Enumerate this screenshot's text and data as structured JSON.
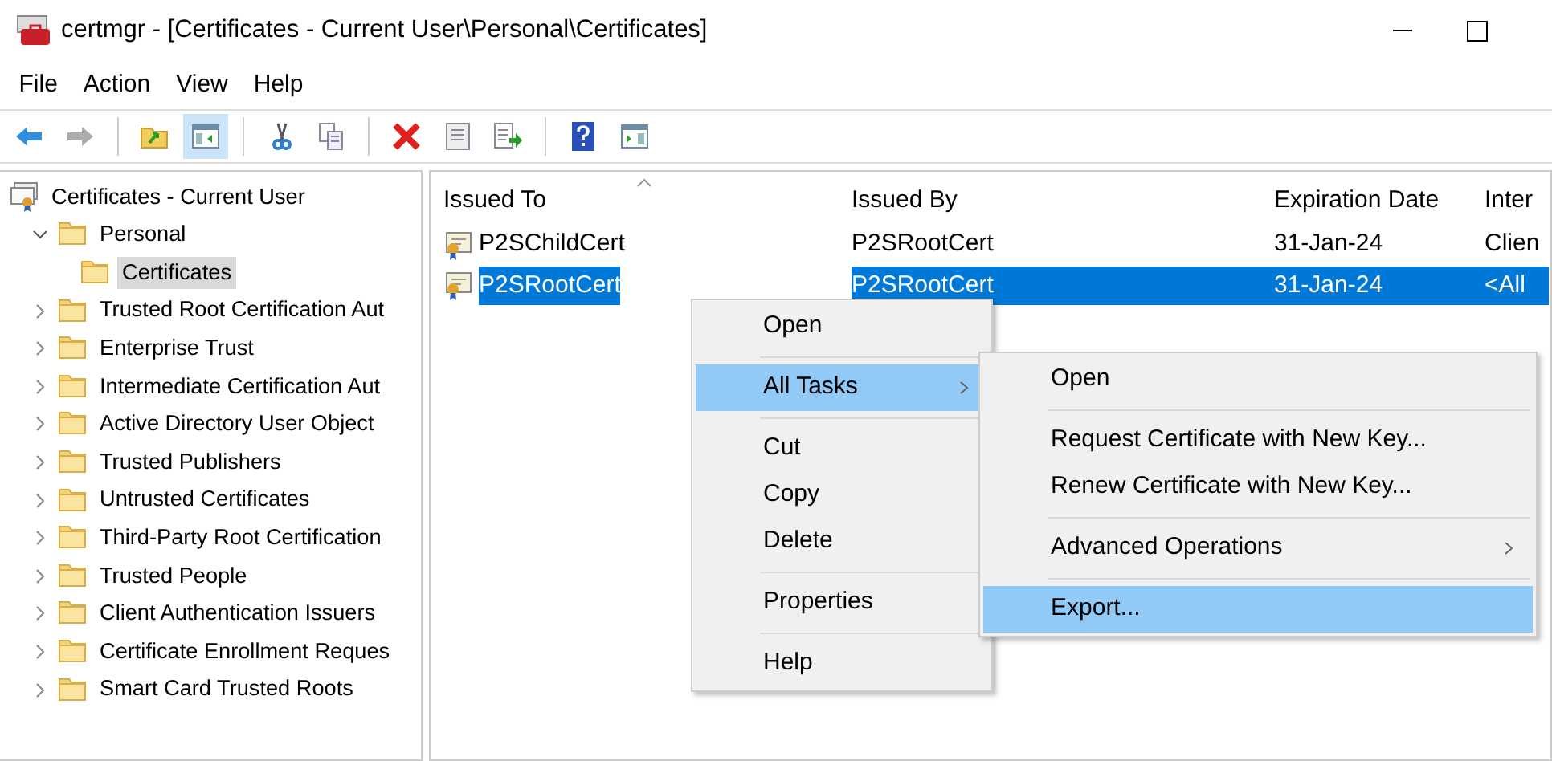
{
  "window": {
    "title": "certmgr - [Certificates - Current User\\Personal\\Certificates]"
  },
  "menubar": [
    "File",
    "Action",
    "View",
    "Help"
  ],
  "toolbar": [
    {
      "kind": "back",
      "disabled": false,
      "pressed": false
    },
    {
      "kind": "forward",
      "disabled": true,
      "pressed": false
    },
    {
      "kind": "sep"
    },
    {
      "kind": "up",
      "disabled": false,
      "pressed": false
    },
    {
      "kind": "tree",
      "disabled": false,
      "pressed": true
    },
    {
      "kind": "sep"
    },
    {
      "kind": "cut",
      "disabled": false,
      "pressed": false
    },
    {
      "kind": "copy",
      "disabled": false,
      "pressed": false
    },
    {
      "kind": "sep"
    },
    {
      "kind": "delete",
      "disabled": false,
      "pressed": false
    },
    {
      "kind": "properties",
      "disabled": false,
      "pressed": false
    },
    {
      "kind": "export",
      "disabled": false,
      "pressed": false
    },
    {
      "kind": "sep"
    },
    {
      "kind": "help",
      "disabled": false,
      "pressed": false
    },
    {
      "kind": "actionpane",
      "disabled": false,
      "pressed": false
    }
  ],
  "tree": [
    {
      "label": "Certificates - Current User",
      "kind": "store",
      "selected": false,
      "children": [
        {
          "label": "Personal",
          "kind": "folder",
          "expanded": true,
          "expandable": true,
          "selected": false,
          "children": [
            {
              "label": "Certificates",
              "kind": "folder",
              "expandable": false,
              "selected": true
            }
          ]
        },
        {
          "label": "Trusted Root Certification Aut",
          "kind": "folder",
          "expanded": false,
          "expandable": true,
          "selected": false
        },
        {
          "label": "Enterprise Trust",
          "kind": "folder",
          "expanded": false,
          "expandable": true,
          "selected": false
        },
        {
          "label": "Intermediate Certification Aut",
          "kind": "folder",
          "expanded": false,
          "expandable": true,
          "selected": false
        },
        {
          "label": "Active Directory User Object",
          "kind": "folder",
          "expanded": false,
          "expandable": true,
          "selected": false
        },
        {
          "label": "Trusted Publishers",
          "kind": "folder",
          "expanded": false,
          "expandable": true,
          "selected": false
        },
        {
          "label": "Untrusted Certificates",
          "kind": "folder",
          "expanded": false,
          "expandable": true,
          "selected": false
        },
        {
          "label": "Third-Party Root Certification",
          "kind": "folder",
          "expanded": false,
          "expandable": true,
          "selected": false
        },
        {
          "label": "Trusted People",
          "kind": "folder",
          "expanded": false,
          "expandable": true,
          "selected": false
        },
        {
          "label": "Client Authentication Issuers",
          "kind": "folder",
          "expanded": false,
          "expandable": true,
          "selected": false
        },
        {
          "label": "Certificate Enrollment Reques",
          "kind": "folder",
          "expanded": false,
          "expandable": true,
          "selected": false
        },
        {
          "label": "Smart Card Trusted Roots",
          "kind": "folder",
          "expanded": false,
          "expandable": true,
          "selected": false
        }
      ]
    }
  ],
  "table": {
    "columns": [
      "Issued To",
      "Issued By",
      "Expiration Date",
      "Inter"
    ],
    "rows": [
      {
        "cells": [
          "P2SChildCert",
          "P2SRootCert",
          "31-Jan-24",
          "Clien"
        ],
        "selected": false
      },
      {
        "cells": [
          "P2SRootCert",
          "P2SRootCert",
          "31-Jan-24",
          "<All"
        ],
        "selected": true
      }
    ]
  },
  "context_menu": {
    "groups": [
      [
        {
          "label": "Open",
          "selected": false,
          "submenu": false
        }
      ],
      [
        {
          "label": "All Tasks",
          "selected": true,
          "submenu": true
        }
      ],
      [
        {
          "label": "Cut",
          "selected": false,
          "submenu": false
        },
        {
          "label": "Copy",
          "selected": false,
          "submenu": false
        },
        {
          "label": "Delete",
          "selected": false,
          "submenu": false
        }
      ],
      [
        {
          "label": "Properties",
          "selected": false,
          "submenu": false
        }
      ],
      [
        {
          "label": "Help",
          "selected": false,
          "submenu": false
        }
      ]
    ]
  },
  "submenu": {
    "groups": [
      [
        {
          "label": "Open",
          "selected": false,
          "submenu": false
        }
      ],
      [
        {
          "label": "Request Certificate with New Key...",
          "selected": false,
          "submenu": false
        },
        {
          "label": "Renew Certificate with New Key...",
          "selected": false,
          "submenu": false
        }
      ],
      [
        {
          "label": "Advanced Operations",
          "selected": false,
          "submenu": true
        }
      ],
      [
        {
          "label": "Export...",
          "selected": true,
          "submenu": false
        }
      ]
    ]
  }
}
